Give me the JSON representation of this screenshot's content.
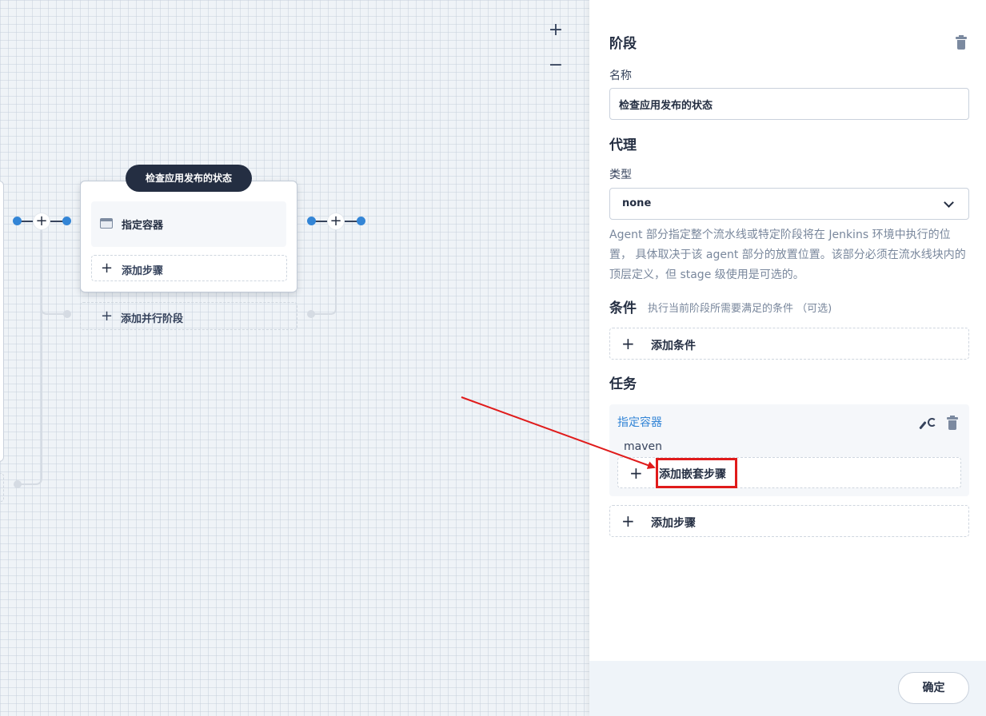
{
  "canvas": {
    "zoom_in_label": "+",
    "zoom_out_label": "−",
    "stage": {
      "title": "检查应用发布的状态",
      "step_label": "指定容器",
      "add_step_label": "添加步骤",
      "add_parallel_label": "添加并行阶段"
    }
  },
  "panel": {
    "title": "阶段",
    "name": {
      "label": "名称",
      "value": "检查应用发布的状态"
    },
    "agent": {
      "title": "代理",
      "type_label": "类型",
      "type_value": "none",
      "help": "Agent 部分指定整个流水线或特定阶段将在 Jenkins 环境中执行的位置， 具体取决于该 agent 部分的放置位置。该部分必须在流水线块内的顶层定义，但 stage 级使用是可选的。"
    },
    "conditions": {
      "title": "条件",
      "subtitle": "执行当前阶段所需要满足的条件 （可选)",
      "add_label": "添加条件"
    },
    "tasks": {
      "title": "任务",
      "item_name": "指定容器",
      "item_value": "maven",
      "add_nested_label": "添加嵌套步骤",
      "add_step_label": "添加步骤"
    },
    "ok_label": "确定"
  },
  "colors": {
    "accent": "#3385d6",
    "dark": "#242e42",
    "annotation_red": "#e01b1b"
  }
}
